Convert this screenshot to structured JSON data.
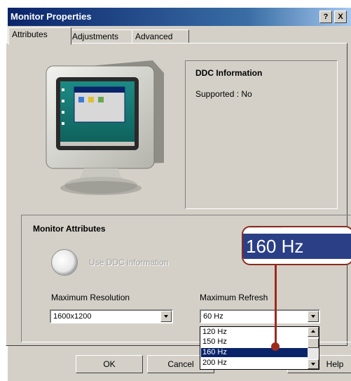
{
  "window": {
    "title": "Monitor Properties",
    "help_button": "?",
    "close_button": "X"
  },
  "tabs": [
    {
      "label": "Attributes",
      "active": true
    },
    {
      "label": "Adjustments",
      "active": false
    },
    {
      "label": "Advanced",
      "active": false
    }
  ],
  "ddc": {
    "heading": "DDC Information",
    "supported_text": "Supported :  No"
  },
  "monitor_attributes": {
    "heading": "Monitor Attributes",
    "use_ddc_label": "Use DDC information",
    "max_resolution_label": "Maximum Resolution",
    "max_resolution_value": "1600x1200",
    "max_refresh_label": "Maximum Refresh",
    "max_refresh_value": "60 Hz",
    "refresh_options": [
      "120 Hz",
      "150 Hz",
      "160 Hz",
      "200 Hz"
    ],
    "selected_option": "160 Hz"
  },
  "buttons": {
    "ok": "OK",
    "cancel": "Cancel",
    "help": "Help"
  },
  "callout": {
    "zoom_text": "160 Hz"
  },
  "colors": {
    "titlebar": "#0a246a",
    "selection": "#0a246a",
    "callout_border": "#8b2a1d",
    "callout_band": "#2b3f86"
  },
  "icons": [
    "monitor-image-icon",
    "chevron-down-icon",
    "scroll-up-icon",
    "scroll-down-icon"
  ]
}
